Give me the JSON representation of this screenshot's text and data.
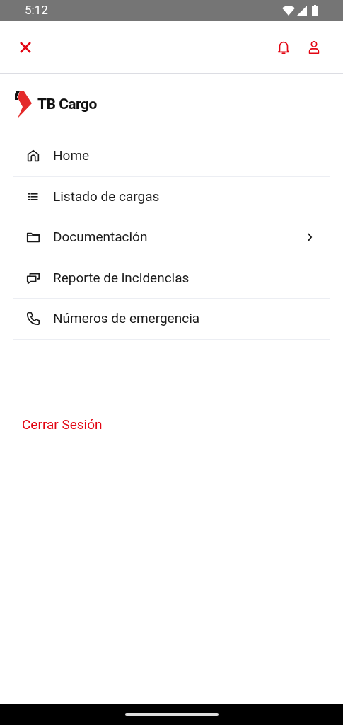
{
  "status_bar": {
    "time": "5:12"
  },
  "brand": {
    "name": "TB Cargo"
  },
  "menu": [
    {
      "label": "Home",
      "has_submenu": false
    },
    {
      "label": "Listado de cargas",
      "has_submenu": false
    },
    {
      "label": "Documentación",
      "has_submenu": true
    },
    {
      "label": "Reporte de incidencias",
      "has_submenu": false
    },
    {
      "label": "Números de emergencia",
      "has_submenu": false
    }
  ],
  "logout": {
    "label": "Cerrar Sesión"
  }
}
